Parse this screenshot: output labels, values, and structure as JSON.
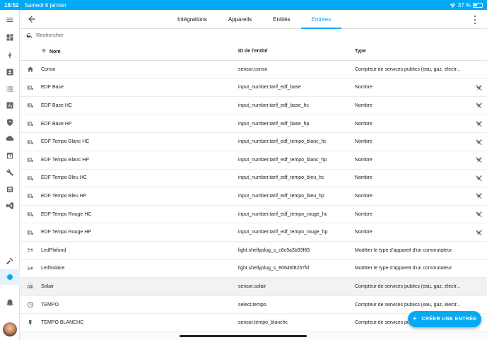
{
  "statusbar": {
    "time": "18:52",
    "date": "Samedi 6 janvier",
    "battery": "37 %",
    "battery_level": 0.37
  },
  "tabs": [
    {
      "label": "Intégrations"
    },
    {
      "label": "Appareils"
    },
    {
      "label": "Entités"
    },
    {
      "label": "Entrées",
      "active": true
    }
  ],
  "search": {
    "placeholder": "Rechercher"
  },
  "table": {
    "headers": {
      "name": "Nom",
      "entity_id": "ID de l'entité",
      "type": "Type"
    },
    "rows": [
      {
        "icon": "home-icon",
        "name": "Conso",
        "entity_id": "sensor.conso",
        "type": "Compteur de services publics (eau, gaz, électr...",
        "action": ""
      },
      {
        "icon": "input-number-icon",
        "name": "EDF Base",
        "entity_id": "input_number.tarif_edf_base",
        "type": "Nombre",
        "action": "pencil-off-icon"
      },
      {
        "icon": "input-number-icon",
        "name": "EDF Base HC",
        "entity_id": "input_number.tarif_edf_base_hc",
        "type": "Nombre",
        "action": "pencil-off-icon"
      },
      {
        "icon": "input-number-icon",
        "name": "EDF Base HP",
        "entity_id": "input_number.tarif_edf_base_hp",
        "type": "Nombre",
        "action": "pencil-off-icon"
      },
      {
        "icon": "input-number-icon",
        "name": "EDF Tempo Blanc HC",
        "entity_id": "input_number.tarif_edf_tempo_blanc_hc",
        "type": "Nombre",
        "action": "pencil-off-icon"
      },
      {
        "icon": "input-number-icon",
        "name": "EDF Tempo Blanc HP",
        "entity_id": "input_number.tarif_edf_tempo_blanc_hp",
        "type": "Nombre",
        "action": "pencil-off-icon"
      },
      {
        "icon": "input-number-icon",
        "name": "EDF Tempo Bleu HC",
        "entity_id": "input_number.tarif_edf_tempo_bleu_hc",
        "type": "Nombre",
        "action": "pencil-off-icon"
      },
      {
        "icon": "input-number-icon",
        "name": "EDF Tempo Bleu HP",
        "entity_id": "input_number.tarif_edf_tempo_bleu_hp",
        "type": "Nombre",
        "action": "pencil-off-icon"
      },
      {
        "icon": "input-number-icon",
        "name": "EDF Tempo Rouge HC",
        "entity_id": "input_number.tarif_edf_tempo_rouge_hc",
        "type": "Nombre",
        "action": "pencil-off-icon"
      },
      {
        "icon": "input-number-icon",
        "name": "EDF Tempo Rouge HP",
        "entity_id": "input_number.tarif_edf_tempo_rouge_hp",
        "type": "Nombre",
        "action": "pencil-off-icon"
      },
      {
        "icon": "switch-light-icon",
        "name": "LedPlafond",
        "entity_id": "light.shellyplug_s_c8c9a3b93f69",
        "type": "Modifier le type d'appareil d'un commutateur",
        "action": ""
      },
      {
        "icon": "switch-light-icon",
        "name": "LedSolaire",
        "entity_id": "light.shellyplug_s_80646f8257fd",
        "type": "Modifier le type d'appareil d'un commutateur",
        "action": ""
      },
      {
        "icon": "solar-panel-icon",
        "name": "Solair",
        "entity_id": "sensor.solair",
        "type": "Compteur de services publics (eau, gaz, électr...",
        "action": "",
        "highlighted": true
      },
      {
        "icon": "clock-icon",
        "name": "TEMPO",
        "entity_id": "select.tempo",
        "type": "Compteur de services publics (eau, gaz, électr...",
        "action": ""
      },
      {
        "icon": "flash-icon",
        "name": "TEMPO BLANCHC",
        "entity_id": "sensor.tempo_blanchc",
        "type": "Compteur de services publics (eau, gaz, électr...",
        "action": ""
      }
    ]
  },
  "fab": {
    "label": "CRÉER UNE ENTRÉE"
  },
  "colors": {
    "accent": "#03a9f4"
  }
}
